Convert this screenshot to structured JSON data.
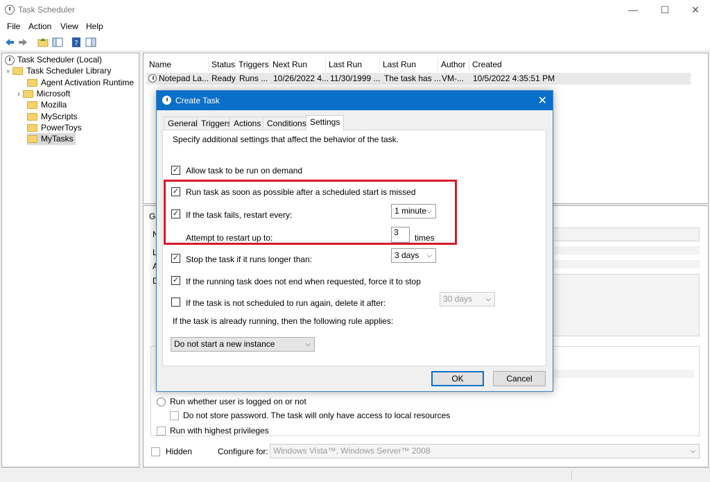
{
  "window": {
    "title": "Task Scheduler",
    "minimize": "—",
    "maximize": "☐",
    "close": "✕"
  },
  "menu": [
    "File",
    "Action",
    "View",
    "Help"
  ],
  "tree": {
    "root": "Task Scheduler (Local)",
    "library": "Task Scheduler Library",
    "folders": [
      "Agent Activation Runtime",
      "Microsoft",
      "Mozilla",
      "MyScripts",
      "PowerToys",
      "MyTasks"
    ]
  },
  "task_list": {
    "columns": [
      "Name",
      "Status",
      "Triggers",
      "Next Run Time",
      "Last Run Time",
      "Last Run Result",
      "Author",
      "Created"
    ],
    "rows": [
      [
        "Notepad La...",
        "Ready",
        "Runs ...",
        "10/26/2022 4...",
        "11/30/1999 ...",
        "The task has ...",
        "VM-...",
        "10/5/2022 4:35:51 PM"
      ]
    ]
  },
  "detail": {
    "tab_fragment": "Ge",
    "letters": [
      "N",
      "L",
      "A",
      "D"
    ],
    "radio_logged": "Run whether user is logged on or not",
    "no_password": "Do not store password.  The task will only have access to local resources",
    "highest": "Run with highest privileges",
    "hidden": "Hidden",
    "configure_label": "Configure for:",
    "configure_value": "Windows Vista™, Windows Server™ 2008"
  },
  "dialog": {
    "title": "Create Task",
    "close": "✕",
    "tabs": [
      "General",
      "Triggers",
      "Actions",
      "Conditions",
      "Settings"
    ],
    "description": "Specify additional settings that affect the behavior of the task.",
    "allow_on_demand": "Allow task to be run on demand",
    "run_missed": "Run task as soon as possible after a scheduled start is missed",
    "restart_every": "If the task fails, restart every:",
    "restart_interval": "1 minute",
    "attempt_label": "Attempt to restart up to:",
    "attempt_value": "3",
    "times": "times",
    "stop_longer": "Stop the task if it runs longer than:",
    "stop_value": "3 days",
    "force_stop": "If the running task does not end when requested, force it to stop",
    "delete_after": "If the task is not scheduled to run again, delete it after:",
    "delete_value": "30 days",
    "rule_label": "If the task is already running, then the following rule applies:",
    "rule_value": "Do not start a new instance",
    "ok": "OK",
    "cancel": "Cancel",
    "check_mark": "✓"
  },
  "colors": {
    "dialog_title": "#0a6fc9",
    "highlight": "#d7192a"
  }
}
